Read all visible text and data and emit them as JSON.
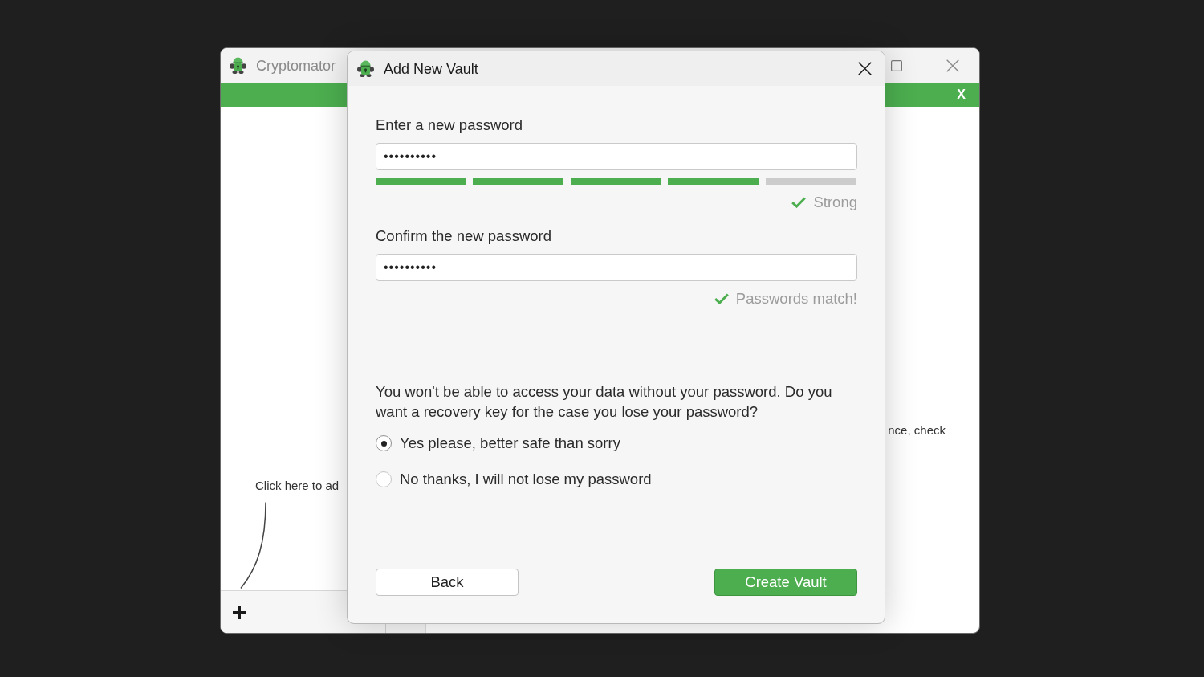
{
  "main_window": {
    "title": "Cryptomator",
    "banner": {
      "close_label": "X"
    },
    "add_vault_hint": "Click here to ad",
    "welcome_text": "nce, check"
  },
  "dialog": {
    "title": "Add New Vault",
    "password": {
      "label": "Enter a new password",
      "value": "••••••••••"
    },
    "strength": {
      "level": 0.8,
      "label": "Strong"
    },
    "confirm": {
      "label": "Confirm the new password",
      "value": "••••••••••"
    },
    "match_message": "Passwords match!",
    "recovery": {
      "question": "You won't be able to access your data without your password. Do you want a recovery key for the case you lose your password?",
      "options": [
        {
          "label": "Yes please, better safe than sorry",
          "selected": true
        },
        {
          "label": "No thanks, I will not lose my password",
          "selected": false
        }
      ]
    },
    "buttons": [
      {
        "label": "Back",
        "kind": "secondary"
      },
      {
        "label": "Create Vault",
        "kind": "primary"
      }
    ]
  }
}
